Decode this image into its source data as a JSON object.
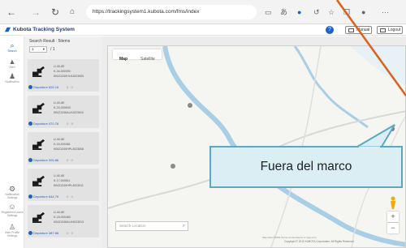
{
  "browser": {
    "back_icon": "back-arrow",
    "forward_icon": "forward-arrow",
    "refresh_icon": "refresh",
    "url": "https://trackingsystem1.kubota.com/fms/index"
  },
  "app": {
    "title": "Kubota Tracking System",
    "help_label": "?",
    "manual_label": "Manual",
    "logout_label": "Logout",
    "brand_color": "#1f62c6"
  },
  "leftnav": {
    "items": [
      {
        "label": "Search",
        "icon": "search-icon",
        "active": true
      },
      {
        "label": "Alert",
        "icon": "warning-icon",
        "active": false
      },
      {
        "label": "Notification",
        "icon": "bell-icon",
        "active": false
      },
      {
        "label": "Notification Settings",
        "icon": "gear-icon",
        "active": false
      },
      {
        "label": "Registered Users Settings",
        "icon": "users-icon",
        "active": false
      },
      {
        "label": "User Profile Settings",
        "icon": "person-icon",
        "active": false
      }
    ]
  },
  "results": {
    "title": "Search Result : 5items",
    "page_value": "1",
    "page_total": "/ 1",
    "cards": [
      {
        "model": "U-40-6E",
        "serial": "K-34-000393",
        "id": "KBCDZ40HLK4023505",
        "status": "Departure",
        "hours": "525.15",
        "extra": "0  ·  0"
      },
      {
        "model": "U-40-6E",
        "serial": "K-23-000543",
        "id": "KBCDZ46ALK4023510",
        "status": "Departure",
        "hours": "470.76",
        "extra": "0  ·  0"
      },
      {
        "model": "U-40-6E",
        "serial": "K-15-000481",
        "id": "KBCDZ40HPL4023508",
        "status": "Departure",
        "hours": "305.86",
        "extra": "0  ·  0"
      },
      {
        "model": "U-40-6E",
        "serial": "K-17-000511",
        "id": "KBCDZ40HPL4023511",
        "status": "Departure",
        "hours": "644.79",
        "extra": "0  ·  0"
      },
      {
        "model": "U-40-6E",
        "serial": "K-18-000460",
        "id": "KBCDZ46ALH4023513",
        "status": "Departure",
        "hours": "387.68",
        "extra": "0  ·  0"
      }
    ]
  },
  "map": {
    "tab_map": "Map",
    "tab_satellite": "Satellite",
    "search_placeholder": "Search Location",
    "footer": "Map data ©2019   Terms of Use   Report a map error",
    "copyright": "Copyright © 2019 KUBOTA Corporation. All Rights Reserved.",
    "zoom_in": "+",
    "zoom_out": "−"
  },
  "callout": {
    "text": "Fuera del marco"
  }
}
